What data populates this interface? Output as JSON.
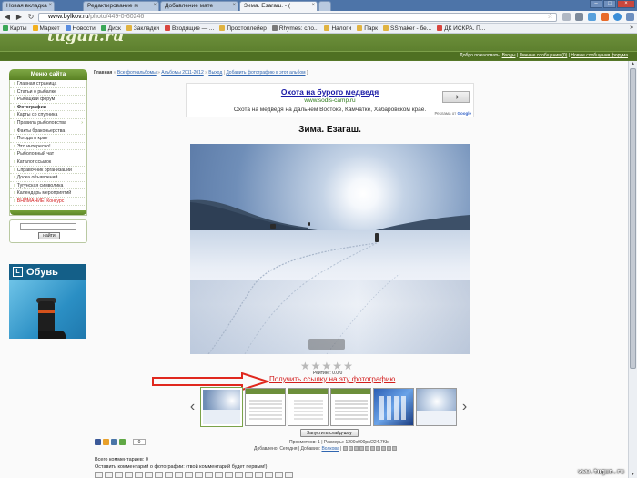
{
  "browser": {
    "tabs": [
      {
        "label": "Новая вкладка",
        "active": false
      },
      {
        "label": "Редактирование м",
        "active": false
      },
      {
        "label": "Добавление мате",
        "active": false
      },
      {
        "label": "Зима. Езагаш. - (",
        "active": true
      },
      {
        "label": "",
        "active": false
      }
    ],
    "url_host": "www.bylkov.ru",
    "url_path": "/photo/449-0-60246",
    "bookmarks": [
      {
        "label": "Карты",
        "color": "#3aa757"
      },
      {
        "label": "Маркет",
        "color": "#f2b01e"
      },
      {
        "label": "Новости",
        "color": "#5a8de0"
      },
      {
        "label": "Диск",
        "color": "#3aa757"
      },
      {
        "label": "Закладки",
        "color": "#e0b341"
      },
      {
        "label": "Входящие — ...",
        "color": "#d9463f"
      },
      {
        "label": "Простоплейер",
        "color": "#e0b341"
      },
      {
        "label": "Rhymes: сло...",
        "color": "#7a7a7a"
      },
      {
        "label": "Налоги",
        "color": "#e0b341"
      },
      {
        "label": "Парк",
        "color": "#e0b341"
      },
      {
        "label": "SSmaker - бе...",
        "color": "#e0b341"
      },
      {
        "label": "ДК ИСКРА. П...",
        "color": "#d9463f"
      }
    ],
    "bookmarks_more": "»"
  },
  "site": {
    "logo": "tugun.ru",
    "header_links_prefix": "Добро пожаловать,",
    "header_link_1": "Входы",
    "header_link_2": "Личные сообщения (0)",
    "header_link_3": "Новые сообщения форума"
  },
  "sidebar": {
    "title": "Меню сайта",
    "items": [
      {
        "label": "Главная страница",
        "bold": false,
        "red": false,
        "arrow": false
      },
      {
        "label": "Статьи о рыбалке",
        "bold": false,
        "red": false,
        "arrow": false
      },
      {
        "label": "Рыбацкий форум",
        "bold": false,
        "red": false,
        "arrow": false
      },
      {
        "label": "Фотографии",
        "bold": true,
        "red": false,
        "arrow": false
      },
      {
        "label": "Карты со спутника",
        "bold": false,
        "red": false,
        "arrow": false
      },
      {
        "label": "Правила рыболовства",
        "bold": false,
        "red": false,
        "arrow": true
      },
      {
        "label": "Факты браконьерства",
        "bold": false,
        "red": false,
        "arrow": false
      },
      {
        "label": "Погода в крае",
        "bold": false,
        "red": false,
        "arrow": false
      },
      {
        "label": "Это интересно!",
        "bold": false,
        "red": false,
        "arrow": false
      },
      {
        "label": "Рыболовный чат",
        "bold": false,
        "red": false,
        "arrow": false
      },
      {
        "label": "Каталог ссылок",
        "bold": false,
        "red": false,
        "arrow": false
      },
      {
        "label": "Справочник организаций",
        "bold": false,
        "red": false,
        "arrow": false
      },
      {
        "label": "Доска объявлений",
        "bold": false,
        "red": false,
        "arrow": false
      },
      {
        "label": "Тугунская символика",
        "bold": false,
        "red": false,
        "arrow": false
      },
      {
        "label": "Календарь мероприятий",
        "bold": false,
        "red": false,
        "arrow": false
      },
      {
        "label": "ВНИМАНИЕ! Конкурс",
        "bold": false,
        "red": true,
        "arrow": false
      }
    ],
    "search_button": "найти",
    "ad_title": "Обувь",
    "ad_logo_letter": "L"
  },
  "breadcrumb": {
    "home": "Главная",
    "crumb1": "Все фотоальбомы",
    "crumb2": "Альбомы 2011-2012",
    "crumb3": "Выход",
    "crumb4": "Добавить фотографию в этот альбом",
    "sep": "»"
  },
  "adsense": {
    "title": "Охота на бурого медведя",
    "url": "www.sodis-camp.ru",
    "desc": "Охота на медведя на Дальнем Востоке, Камчатке, Хабаровском крае.",
    "arrow": "➜",
    "by_prefix": "Реклама от",
    "by_brand": "Google"
  },
  "photo": {
    "title": "Зима. Езагаш.",
    "rating_text": "Рейтинг: 0.0/0",
    "stars": [
      "★",
      "★",
      "★",
      "★",
      "★"
    ],
    "get_link": "Получить ссылку на эту фотографию",
    "slideshow": "Запустить слайд-шоу",
    "prev_arrow": "‹",
    "next_arrow": "›"
  },
  "meta": {
    "views_size": "Просмотров: 1 | Размеры: 1200x900px/224.7Kb",
    "added_prefix": "Добавлено: Сегодня | Добавил:",
    "added_user": "Волкова",
    "share_count": "0"
  },
  "comments": {
    "count_label": "Всего комментариев: 0",
    "note": "Оставить комментарий о фотографии: (твой комментарий будет первым!)"
  },
  "watermark": "www.tugun.ru"
}
